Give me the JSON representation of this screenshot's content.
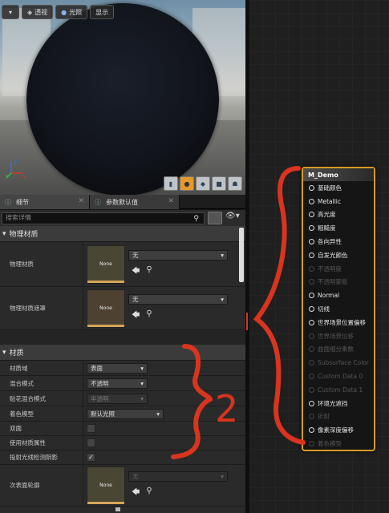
{
  "viewport": {
    "toolbar": {
      "perspective_label": "透视",
      "lit_label": "光照",
      "show_label": "显示"
    }
  },
  "tabs": [
    {
      "label": "细节"
    },
    {
      "label": "参数默认值"
    }
  ],
  "search": {
    "placeholder": "搜索详情"
  },
  "details": {
    "physical_category": "物理材质",
    "physical_material_label": "物理材质",
    "physical_mask_label": "物理材质遮罩",
    "none_thumb": "None",
    "none_value": "无",
    "material_category": "材质",
    "domain_label": "材质域",
    "domain_value": "表面",
    "blend_label": "混合模式",
    "blend_value": "不透明",
    "decal_blend_label": "贴花混合模式",
    "decal_blend_value": "半透明",
    "shading_label": "着色模型",
    "shading_value": "默认光照",
    "two_sided_label": "双面",
    "use_attr_label": "使用材质属性",
    "raytraced_label": "投射光线检测阴影",
    "subsurface_label": "次表面轮廓"
  },
  "node": {
    "title": "M_Demo",
    "pins": [
      {
        "label": "基础颜色",
        "enabled": true
      },
      {
        "label": "Metallic",
        "enabled": true
      },
      {
        "label": "高光度",
        "enabled": true
      },
      {
        "label": "粗糙度",
        "enabled": true
      },
      {
        "label": "各向异性",
        "enabled": true
      },
      {
        "label": "自发光颜色",
        "enabled": true
      },
      {
        "label": "不透明度",
        "enabled": false
      },
      {
        "label": "不透明蒙版",
        "enabled": false
      },
      {
        "label": "Normal",
        "enabled": true
      },
      {
        "label": "切线",
        "enabled": true
      },
      {
        "label": "世界场景位置偏移",
        "enabled": true
      },
      {
        "label": "世界场景位移",
        "enabled": false
      },
      {
        "label": "曲面细分乘数",
        "enabled": false
      },
      {
        "label": "Subsurface Color",
        "enabled": false
      },
      {
        "label": "Custom Data 0",
        "enabled": false
      },
      {
        "label": "Custom Data 1",
        "enabled": false
      },
      {
        "label": "环境光遮挡",
        "enabled": true
      },
      {
        "label": "折射",
        "enabled": false
      },
      {
        "label": "像素深度偏移",
        "enabled": true
      },
      {
        "label": "着色模型",
        "enabled": false
      }
    ]
  },
  "annotation": {
    "number": "2",
    "color": "#d9341f"
  },
  "colors": {
    "accent": "#d49b27",
    "annotation": "#d9341f"
  }
}
